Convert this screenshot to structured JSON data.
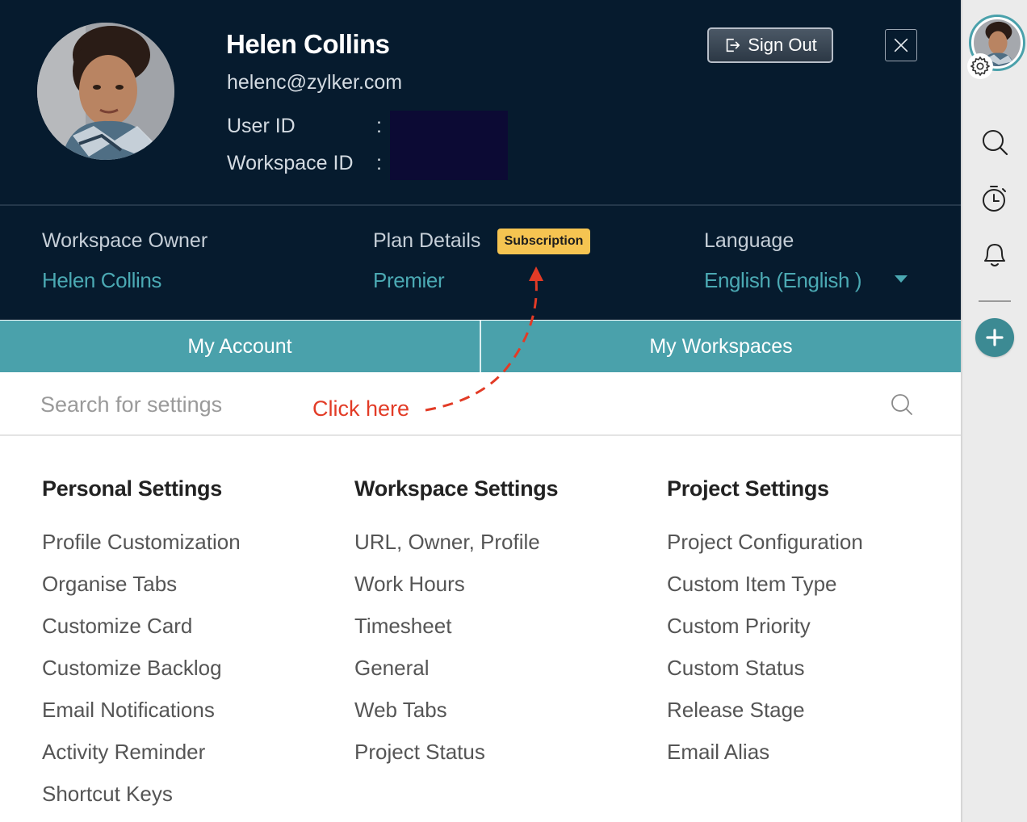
{
  "header": {
    "user_name": "Helen Collins",
    "user_email": "helenc@zylker.com",
    "user_id_label": "User ID",
    "workspace_id_label": "Workspace ID",
    "separator": ":",
    "sign_out_label": "Sign Out"
  },
  "info": {
    "owner_label": "Workspace Owner",
    "owner_value": "Helen Collins",
    "plan_label": "Plan Details",
    "plan_value": "Premier",
    "subscription_badge": "Subscription",
    "language_label": "Language",
    "language_value": "English (English )"
  },
  "tabs": [
    {
      "label": "My Account"
    },
    {
      "label": "My Workspaces"
    }
  ],
  "search": {
    "placeholder": "Search for settings"
  },
  "annotation": {
    "text": "Click here"
  },
  "sections": {
    "personal": {
      "title": "Personal Settings",
      "items": [
        "Profile Customization",
        "Organise Tabs",
        "Customize Card",
        "Customize Backlog",
        "Email Notifications",
        "Activity Reminder",
        "Shortcut Keys"
      ]
    },
    "workspace": {
      "title": "Workspace Settings",
      "items": [
        "URL, Owner, Profile",
        "Work Hours",
        "Timesheet",
        "General",
        "Web Tabs",
        "Project Status"
      ]
    },
    "project": {
      "title": "Project Settings",
      "items": [
        "Project Configuration",
        "Custom Item Type",
        "Custom Priority",
        "Custom Status",
        "Release Stage",
        "Email Alias"
      ]
    }
  },
  "icons": {
    "sign_out": "sign-out-icon",
    "close": "close-icon",
    "search": "search-icon",
    "dropdown": "chevron-down-icon",
    "gear": "gear-icon",
    "timer": "timer-icon",
    "bell": "bell-icon",
    "add": "plus-icon"
  },
  "colors": {
    "header_bg": "#061b2e",
    "accent_teal": "#4aa1ab",
    "badge_yellow": "#f5c451",
    "annotation_red": "#e23b26"
  }
}
